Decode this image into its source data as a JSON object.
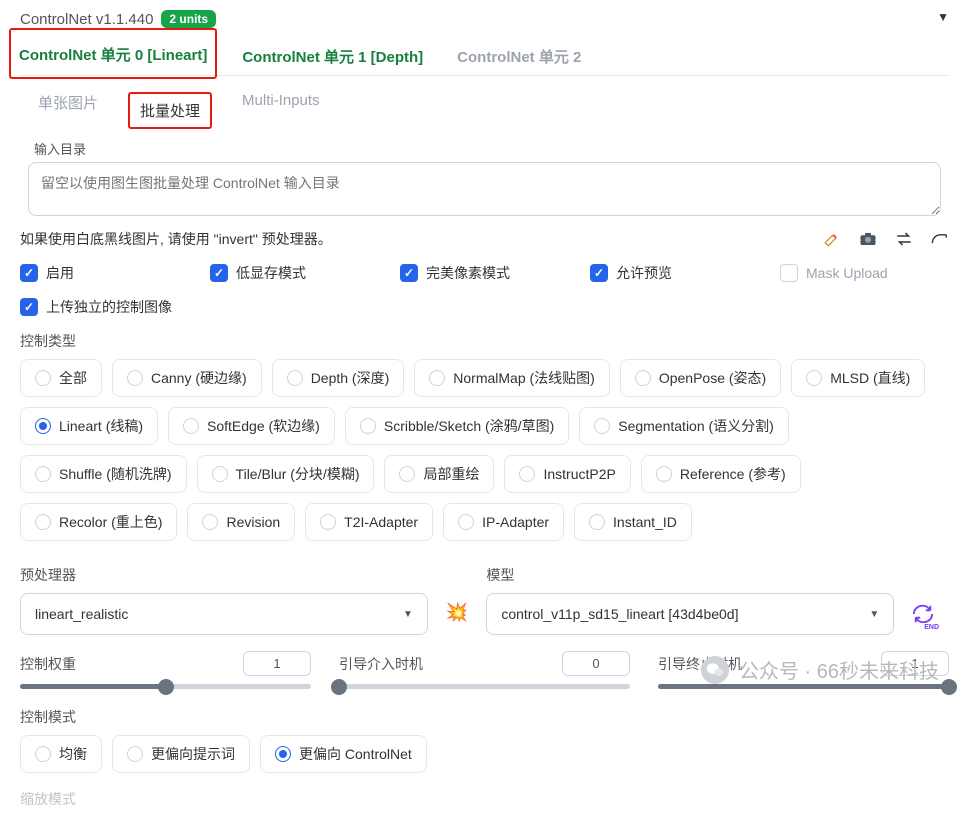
{
  "header": {
    "title": "ControlNet v1.1.440",
    "badge": "2 units"
  },
  "unit_tabs": [
    {
      "label": "ControlNet 单元 0 [Lineart]",
      "active": true
    },
    {
      "label": "ControlNet 单元 1 [Depth]",
      "enabled": true
    },
    {
      "label": "ControlNet 单元 2"
    }
  ],
  "sub_tabs": {
    "single": "单张图片",
    "batch": "批量处理",
    "multi": "Multi-Inputs"
  },
  "input_dir": {
    "label": "输入目录",
    "placeholder": "留空以使用图生图批量处理 ControlNet 输入目录"
  },
  "hint": "如果使用白底黑线图片, 请使用 \"invert\" 预处理器。",
  "checks": {
    "enable": "启用",
    "lowvram": "低显存模式",
    "pixel_perfect": "完美像素模式",
    "allow_preview": "允许预览",
    "mask_upload": "Mask Upload",
    "independent": "上传独立的控制图像"
  },
  "control_type_label": "控制类型",
  "control_types": [
    "全部",
    "Canny (硬边缘)",
    "Depth (深度)",
    "NormalMap (法线贴图)",
    "OpenPose (姿态)",
    "MLSD (直线)",
    "Lineart (线稿)",
    "SoftEdge (软边缘)",
    "Scribble/Sketch (涂鸦/草图)",
    "Segmentation (语义分割)",
    "Shuffle (随机洗牌)",
    "Tile/Blur (分块/模糊)",
    "局部重绘",
    "InstructP2P",
    "Reference (参考)",
    "Recolor (重上色)",
    "Revision",
    "T2I-Adapter",
    "IP-Adapter",
    "Instant_ID"
  ],
  "control_type_selected": 6,
  "preprocessor": {
    "label": "预处理器",
    "value": "lineart_realistic"
  },
  "model": {
    "label": "模型",
    "value": "control_v11p_sd15_lineart [43d4be0d]"
  },
  "sliders": {
    "weight": {
      "label": "控制权重",
      "value": "1",
      "pct": 50
    },
    "start": {
      "label": "引导介入时机",
      "value": "0",
      "pct": 0
    },
    "end": {
      "label": "引导终止时机",
      "value": "1",
      "pct": 100
    }
  },
  "control_mode": {
    "label": "控制模式",
    "options": [
      "均衡",
      "更偏向提示词",
      "更偏向 ControlNet"
    ],
    "selected": 2
  },
  "resize_mode_label": "缩放模式",
  "watermark": "公众号 · 66秒未来科技"
}
